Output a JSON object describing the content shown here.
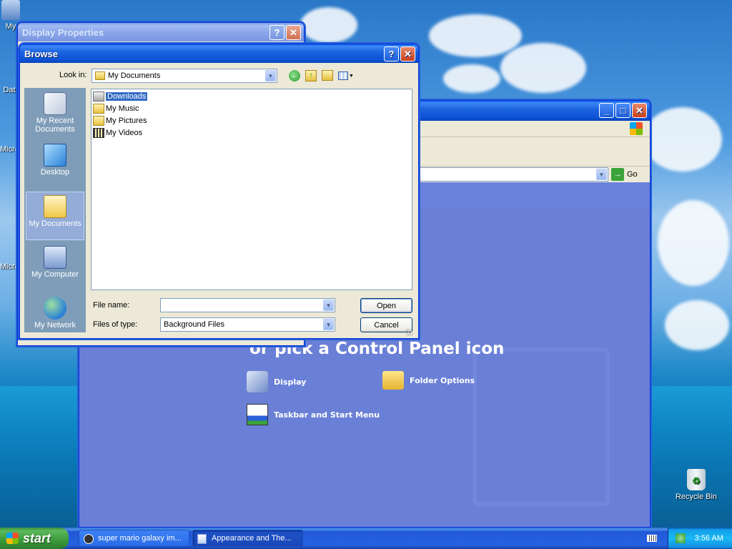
{
  "desktop": {
    "icons": [
      {
        "label": "My"
      },
      {
        "label": "Dat"
      },
      {
        "label": "Micro"
      },
      {
        "label": "Micro"
      },
      {
        "label": "Recycle Bin"
      }
    ]
  },
  "display_properties": {
    "title": "Display Properties",
    "help": "?",
    "close": "✕"
  },
  "control_panel": {
    "heading": "or pick a Control Panel icon",
    "address_go": "Go",
    "items": [
      {
        "label": "Display"
      },
      {
        "label": "Folder Options"
      },
      {
        "label": "Taskbar and Start Menu"
      }
    ],
    "min": "_",
    "max": "□",
    "close": "✕"
  },
  "browse": {
    "title": "Browse",
    "help": "?",
    "close": "✕",
    "look_in_label": "Look in:",
    "look_in_value": "My Documents",
    "places": [
      {
        "label": "My Recent Documents"
      },
      {
        "label": "Desktop"
      },
      {
        "label": "My Documents"
      },
      {
        "label": "My Computer"
      },
      {
        "label": "My Network"
      }
    ],
    "files": [
      {
        "name": "Downloads"
      },
      {
        "name": "My Music"
      },
      {
        "name": "My Pictures"
      },
      {
        "name": "My Videos"
      }
    ],
    "file_name_label": "File name:",
    "file_name_value": "",
    "files_of_type_label": "Files of type:",
    "files_of_type_value": "Background Files",
    "open_label": "Open",
    "cancel_label": "Cancel"
  },
  "taskbar": {
    "start": "start",
    "tasks": [
      {
        "label": "super mario galaxy im..."
      },
      {
        "label": "Appearance and The..."
      }
    ],
    "clock": "3:56 AM"
  },
  "colors": {
    "title_active": "#0b52d6",
    "selection": "#316ac5",
    "cp_bg": "#6078d4"
  }
}
